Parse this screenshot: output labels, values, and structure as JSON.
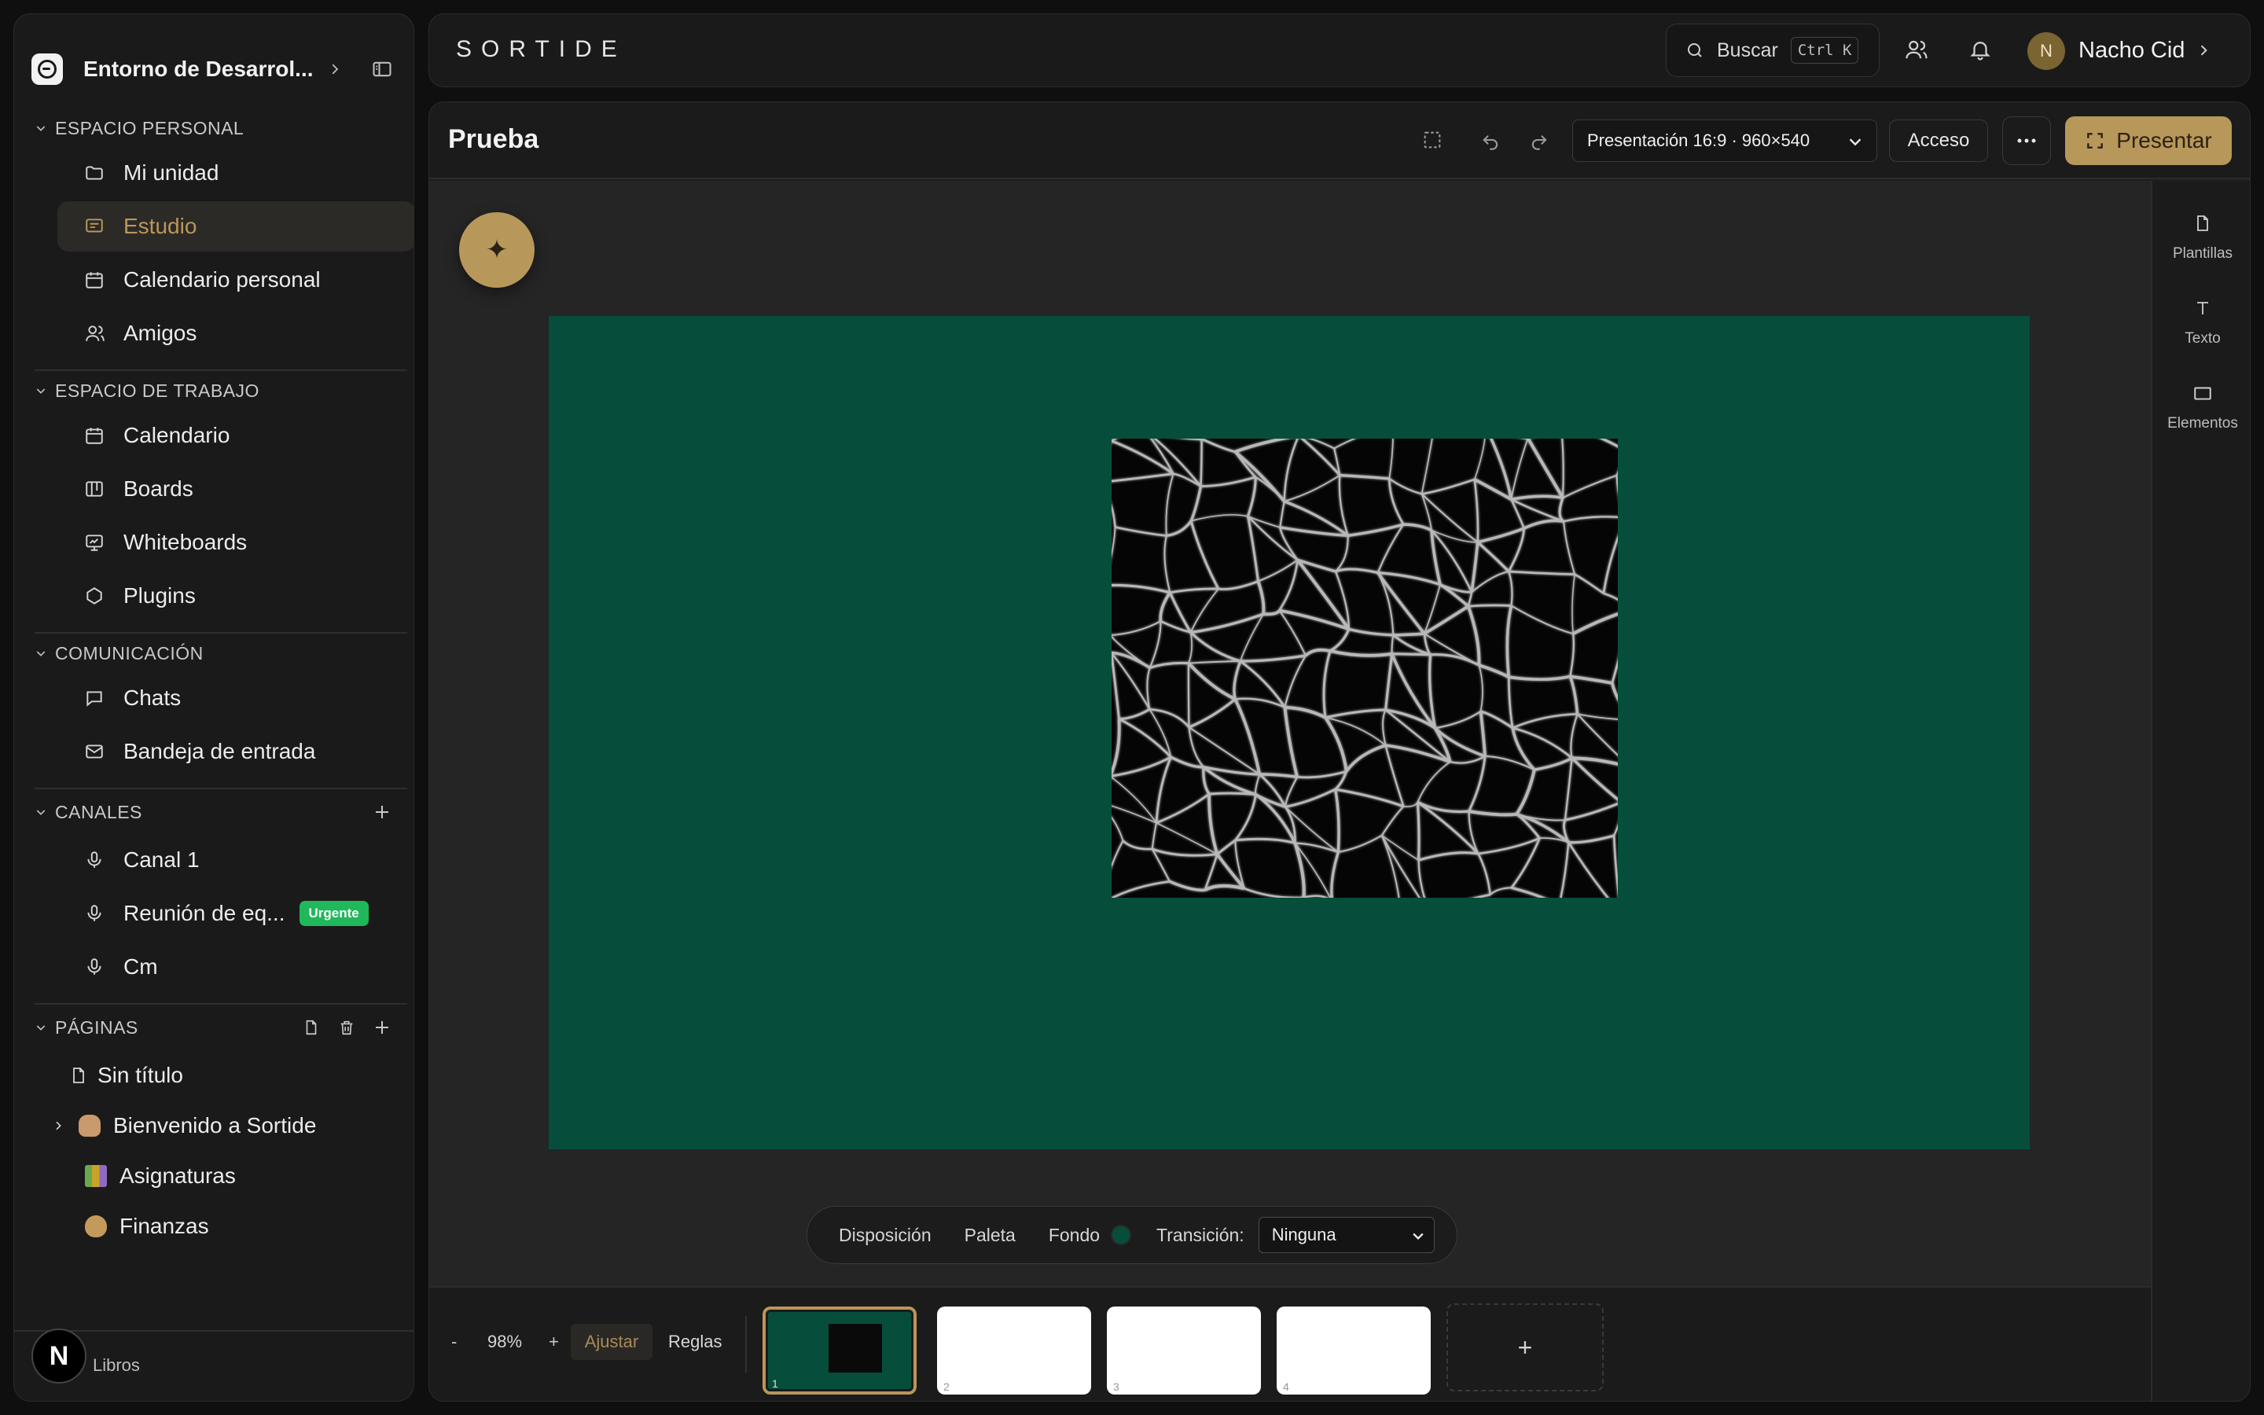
{
  "workspace": {
    "name": "Entorno de Desarrol..."
  },
  "sidebar": {
    "personal": {
      "title": "ESPACIO PERSONAL",
      "items": [
        {
          "label": "Mi unidad",
          "icon": "folder-icon"
        },
        {
          "label": "Estudio",
          "icon": "presentation-icon",
          "active": true
        },
        {
          "label": "Calendario personal",
          "icon": "calendar-icon"
        },
        {
          "label": "Amigos",
          "icon": "users-icon"
        }
      ]
    },
    "workspace": {
      "title": "ESPACIO DE TRABAJO",
      "items": [
        {
          "label": "Calendario",
          "icon": "calendar-icon"
        },
        {
          "label": "Boards",
          "icon": "board-icon"
        },
        {
          "label": "Whiteboards",
          "icon": "whiteboard-icon"
        },
        {
          "label": "Plugins",
          "icon": "plugin-icon"
        }
      ]
    },
    "communication": {
      "title": "COMUNICACIÓN",
      "items": [
        {
          "label": "Chats",
          "icon": "chat-icon"
        },
        {
          "label": "Bandeja de entrada",
          "icon": "mail-icon"
        }
      ]
    },
    "channels": {
      "title": "CANALES",
      "items": [
        {
          "label": "Canal 1",
          "icon": "mic-icon"
        },
        {
          "label": "Reunión de eq...",
          "icon": "mic-icon",
          "badge": "Urgente"
        },
        {
          "label": "Cm",
          "icon": "mic-icon"
        }
      ]
    },
    "pages": {
      "title": "PÁGINAS",
      "items": [
        {
          "label": "Sin título",
          "icon": "file-icon"
        },
        {
          "label": "Bienvenido a Sortide",
          "icon": "hand-emoji"
        },
        {
          "label": "Asignaturas",
          "icon": "books-emoji"
        },
        {
          "label": "Finanzas",
          "icon": "money-bag-emoji"
        }
      ]
    },
    "footer_label": "Libros",
    "footer_badge": "N"
  },
  "topbar": {
    "brand": "SORTIDE",
    "search_label": "Buscar",
    "search_shortcut": "Ctrl K",
    "user_initial": "N",
    "user_name": "Nacho Cid"
  },
  "editor": {
    "title": "Prueba",
    "format": "Presentación 16:9 · 960×540",
    "access_label": "Acceso",
    "present_label": "Presentar",
    "ai_button": "✦",
    "slide_background": "#064e3b",
    "toolbar": {
      "layout": "Disposición",
      "palette": "Paleta",
      "background": "Fondo",
      "transition_label": "Transición:",
      "transition_value": "Ninguna"
    },
    "right_panel": [
      {
        "label": "Plantillas",
        "icon": "template-icon"
      },
      {
        "label": "Texto",
        "icon": "text-icon"
      },
      {
        "label": "Elementos",
        "icon": "shapes-icon"
      }
    ],
    "bottom": {
      "zoom_minus": "-",
      "zoom_value": "98%",
      "zoom_plus": "+",
      "fit_label": "Ajustar",
      "rulers_label": "Reglas",
      "slides": [
        "1",
        "2",
        "3",
        "4"
      ],
      "add_slide": "+"
    }
  },
  "colors": {
    "accent": "#b8975a",
    "slide_bg": "#064e3b",
    "urgent": "#1fb85a"
  }
}
